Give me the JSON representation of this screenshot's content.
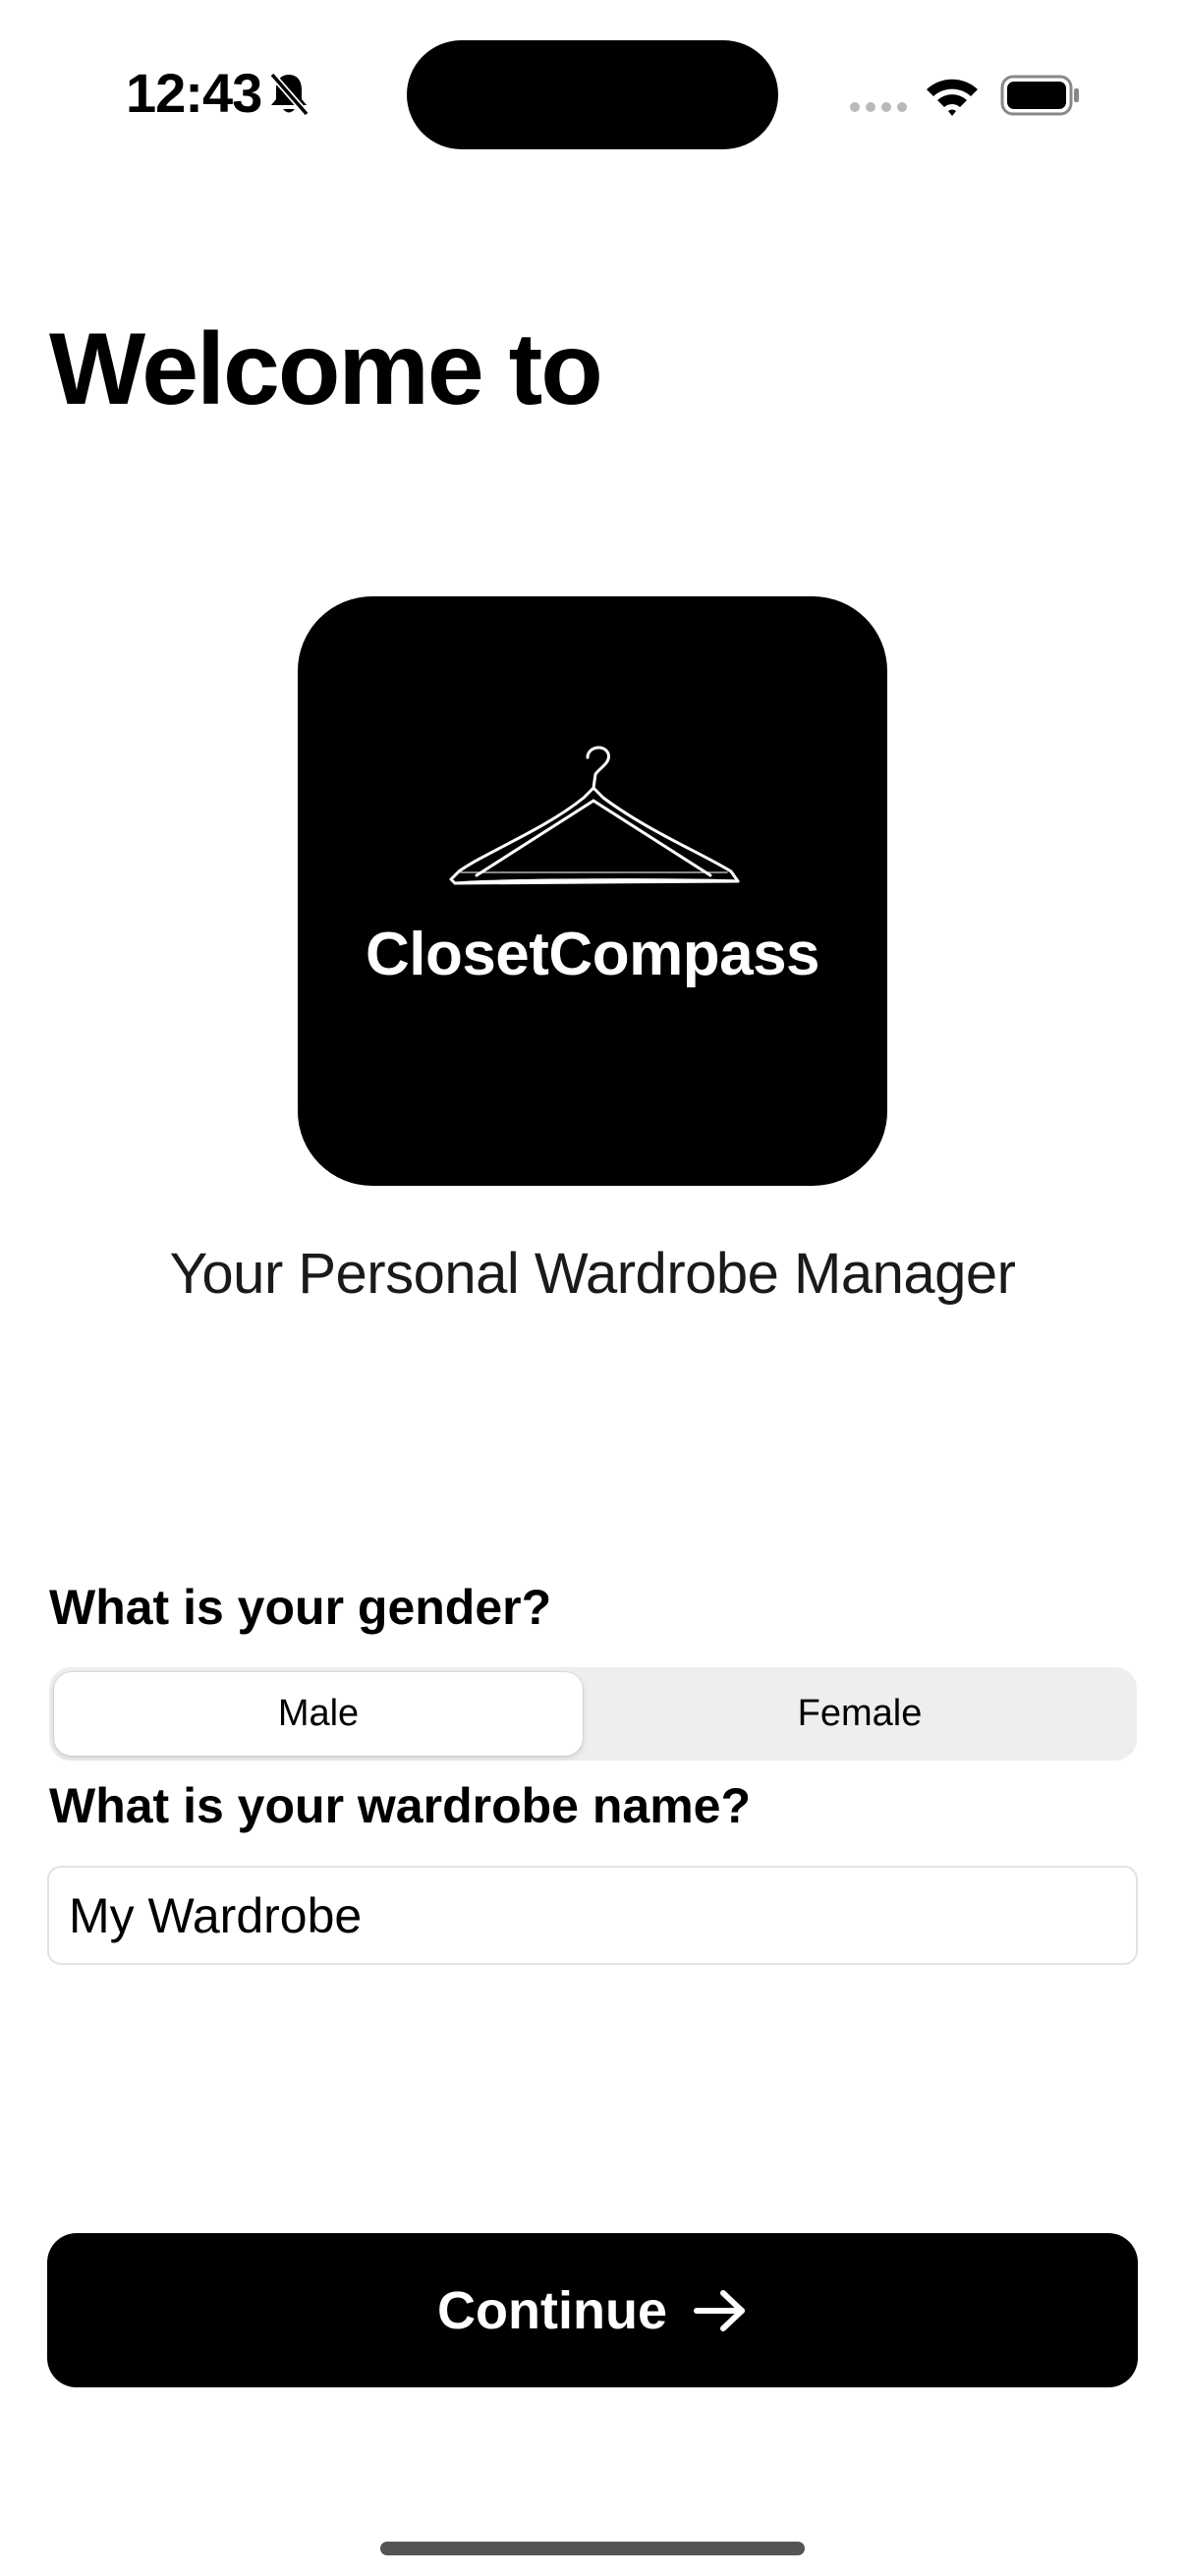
{
  "status_bar": {
    "time": "12:43",
    "icons": [
      "bell-slash-icon",
      "cellular-signal-icon",
      "wifi-icon",
      "battery-icon"
    ]
  },
  "header": {
    "title": "Welcome to"
  },
  "logo": {
    "app_name": "ClosetCompass",
    "icon": "hanger-icon"
  },
  "tagline": "Your Personal Wardrobe Manager",
  "form": {
    "gender_question": "What is your gender?",
    "gender_options": [
      "Male",
      "Female"
    ],
    "gender_selected": "Male",
    "wardrobe_question": "What is your wardrobe name?",
    "wardrobe_name_value": "My Wardrobe"
  },
  "actions": {
    "continue_label": "Continue",
    "continue_icon": "arrow-right-icon"
  },
  "colors": {
    "background": "#ffffff",
    "primary": "#000000",
    "segment_track": "#eeeeef"
  }
}
